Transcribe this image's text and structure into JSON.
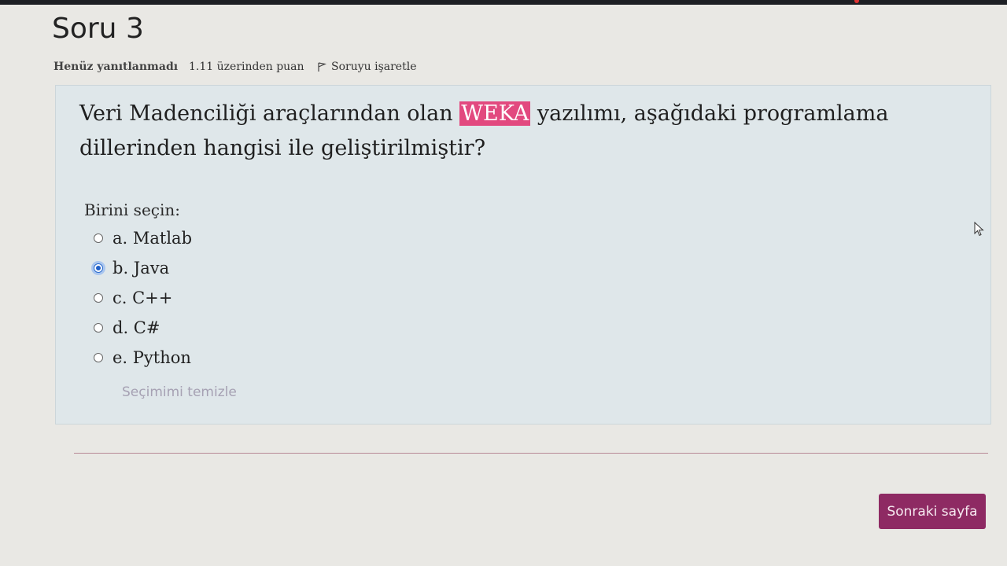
{
  "question": {
    "title": "Soru 3",
    "status": "Henüz yanıtlanmadı",
    "grade": "1.11 üzerinden puan",
    "flag_label": "Soruyu işaretle",
    "text_before": "Veri Madenciliği araçlarından olan ",
    "highlight": "WEKA",
    "text_after": " yazılımı, aşağıdaki programlama dillerinden hangisi ile geliştirilmiştir?",
    "prompt": "Birini seçin:",
    "options": [
      {
        "label": "a. Matlab",
        "selected": false
      },
      {
        "label": "b. Java",
        "selected": true
      },
      {
        "label": "c. C++",
        "selected": false
      },
      {
        "label": "d. C#",
        "selected": false
      },
      {
        "label": "e. Python",
        "selected": false
      }
    ],
    "clear_label": "Seçimimi temizle"
  },
  "navigation": {
    "next_label": "Sonraki sayfa"
  },
  "colors": {
    "highlight": "#e2497f",
    "button": "#8e2a63",
    "question_box": "#dfe7ea"
  },
  "icons": {
    "flag": "flag-icon",
    "cursor": "mouse-cursor-icon"
  }
}
